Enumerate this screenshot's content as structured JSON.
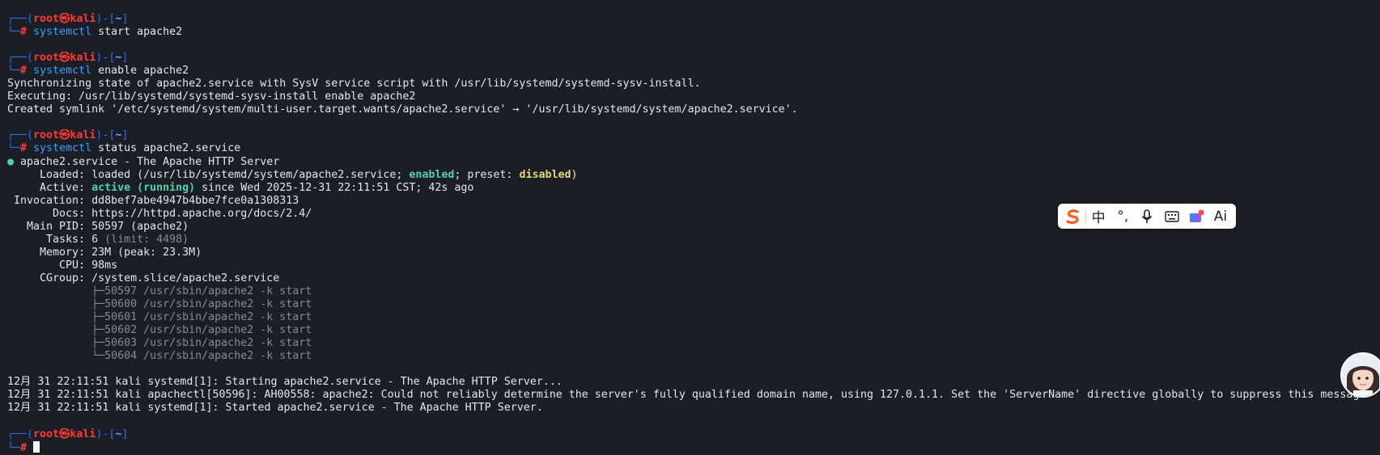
{
  "prompt": {
    "top_left": "┌──(",
    "user": "root",
    "at": "㉿",
    "host": "kali",
    "mid": ")-[",
    "dir": "~",
    "end": "]",
    "bottom": "└─",
    "hash": "#"
  },
  "block1": {
    "cmd1": "systemctl",
    "args": " start apache2"
  },
  "block2": {
    "cmd1": "systemctl",
    "args": " enable apache2",
    "out": [
      "Synchronizing state of apache2.service with SysV service script with /usr/lib/systemd/systemd-sysv-install.",
      "Executing: /usr/lib/systemd/systemd-sysv-install enable apache2",
      "Created symlink '/etc/systemd/system/multi-user.target.wants/apache2.service' → '/usr/lib/systemd/system/apache2.service'."
    ]
  },
  "block3": {
    "cmd1": "systemctl",
    "args": " status apache2.service",
    "dot": "●",
    "service_line": " apache2.service - The Apache HTTP Server",
    "loaded_label": "     Loaded: ",
    "loaded_pre": "loaded (/usr/lib/systemd/system/apache2.service; ",
    "enabled": "enabled",
    "loaded_mid": "; preset: ",
    "disabled": "disabled",
    "loaded_end": ")",
    "active_label": "     Active: ",
    "active": "active (running)",
    "active_rest": " since Wed 2025-12-31 22:11:51 CST; 42s ago",
    "invocation": " Invocation: dd8bef7abe4947b4bbe7fce0a1308313",
    "docs": "       Docs: https://httpd.apache.org/docs/2.4/",
    "mainpid": "   Main PID: 50597 (apache2)",
    "tasks_label": "      Tasks: 6",
    "tasks_limit": " (limit: 4498)",
    "memory": "     Memory: 23M (peak: 23.3M)",
    "cpu": "        CPU: 98ms",
    "cgroup": "     CGroup: /system.slice/apache2.service",
    "procs": [
      "             ├─50597 /usr/sbin/apache2 -k start",
      "             ├─50600 /usr/sbin/apache2 -k start",
      "             ├─50601 /usr/sbin/apache2 -k start",
      "             ├─50602 /usr/sbin/apache2 -k start",
      "             ├─50603 /usr/sbin/apache2 -k start",
      "             └─50604 /usr/sbin/apache2 -k start"
    ],
    "logs": [
      "12月 31 22:11:51 kali systemd[1]: Starting apache2.service - The Apache HTTP Server...",
      "12月 31 22:11:51 kali apachectl[50596]: AH00558: apache2: Could not reliably determine the server's fully qualified domain name, using 127.0.1.1. Set the 'ServerName' directive globally to suppress this message",
      "12月 31 22:11:51 kali systemd[1]: Started apache2.service - The Apache HTTP Server."
    ]
  },
  "ime": {
    "logo": "S",
    "chinese": "中",
    "punct": "°,",
    "mic_icon": "microphone-icon",
    "keyboard_icon": "keyboard-icon",
    "skin_icon": "skin-icon",
    "ai": "Ai"
  },
  "colors": {
    "bg": "#1b1e26",
    "accent_red": "#ff3b30",
    "accent_blue": "#2f6fe0",
    "green": "#4fd4a6",
    "yellow": "#e9d867"
  }
}
